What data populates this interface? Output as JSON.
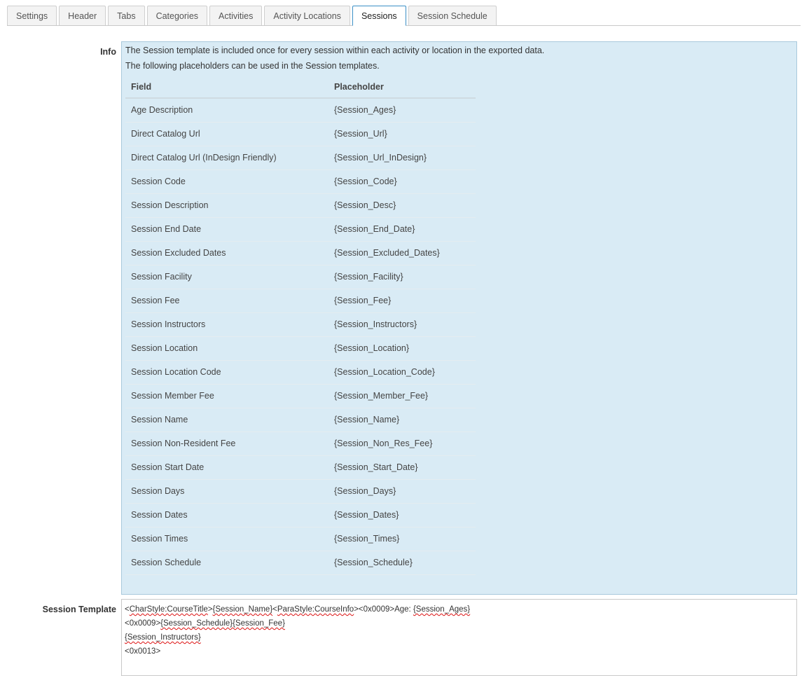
{
  "tabs": [
    {
      "label": "Settings",
      "active": false
    },
    {
      "label": "Header",
      "active": false
    },
    {
      "label": "Tabs",
      "active": false
    },
    {
      "label": "Categories",
      "active": false
    },
    {
      "label": "Activities",
      "active": false
    },
    {
      "label": "Activity Locations",
      "active": false
    },
    {
      "label": "Sessions",
      "active": true
    },
    {
      "label": "Session Schedule",
      "active": false
    }
  ],
  "info": {
    "label": "Info",
    "line1": "The Session template is included once for every session within each activity or location in the exported data.",
    "line2": "The following placeholders can be used in the Session templates.",
    "columns": {
      "field": "Field",
      "placeholder": "Placeholder"
    },
    "rows": [
      {
        "field": "Age Description",
        "placeholder": "{Session_Ages}"
      },
      {
        "field": "Direct Catalog Url",
        "placeholder": "{Session_Url}"
      },
      {
        "field": "Direct Catalog Url (InDesign Friendly)",
        "placeholder": "{Session_Url_InDesign}"
      },
      {
        "field": "Session Code",
        "placeholder": "{Session_Code}"
      },
      {
        "field": "Session Description",
        "placeholder": "{Session_Desc}"
      },
      {
        "field": "Session End Date",
        "placeholder": "{Session_End_Date}"
      },
      {
        "field": "Session Excluded Dates",
        "placeholder": "{Session_Excluded_Dates}"
      },
      {
        "field": "Session Facility",
        "placeholder": "{Session_Facility}"
      },
      {
        "field": "Session Fee",
        "placeholder": "{Session_Fee}"
      },
      {
        "field": "Session Instructors",
        "placeholder": "{Session_Instructors}"
      },
      {
        "field": "Session Location",
        "placeholder": "{Session_Location}"
      },
      {
        "field": "Session Location Code",
        "placeholder": "{Session_Location_Code}"
      },
      {
        "field": "Session Member Fee",
        "placeholder": "{Session_Member_Fee}"
      },
      {
        "field": "Session Name",
        "placeholder": "{Session_Name}"
      },
      {
        "field": "Session Non-Resident Fee",
        "placeholder": "{Session_Non_Res_Fee}"
      },
      {
        "field": "Session Start Date",
        "placeholder": "{Session_Start_Date}"
      },
      {
        "field": "Session Days",
        "placeholder": "{Session_Days}"
      },
      {
        "field": "Session Dates",
        "placeholder": "{Session_Dates}"
      },
      {
        "field": "Session Times",
        "placeholder": "{Session_Times}"
      },
      {
        "field": "Session Schedule",
        "placeholder": "{Session_Schedule}"
      }
    ]
  },
  "template": {
    "label": "Session Template",
    "lines": [
      [
        [
          "<",
          false
        ],
        [
          "CharStyle:CourseTitle",
          true
        ],
        [
          ">",
          false
        ],
        [
          "{Session_Name}",
          true
        ],
        [
          "<",
          false
        ],
        [
          "ParaStyle:CourseInfo",
          true
        ],
        [
          "><0x0009>Age: ",
          false
        ],
        [
          "{Session_Ages}",
          true
        ]
      ],
      [
        [
          "<0x0009>",
          false
        ],
        [
          "{Session_Schedule}{Session_Fee}",
          true
        ]
      ],
      [
        [
          "{Session_Instructors}",
          true
        ]
      ],
      [
        [
          "<0x0013>",
          false
        ]
      ]
    ]
  }
}
